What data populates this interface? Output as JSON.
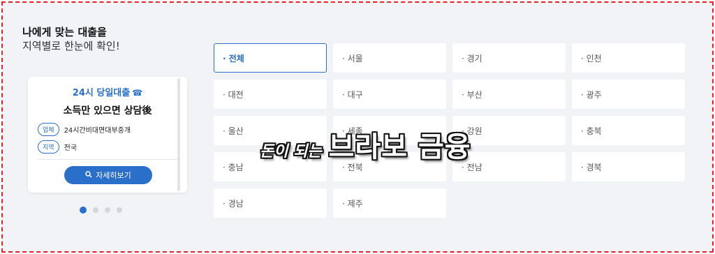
{
  "headline": {
    "line1": "나에게 맞는 대출을",
    "line2": "지역별로 한눈에 확인!"
  },
  "card": {
    "title": "24시 당일대출",
    "title_icon": "phone-icon",
    "subtitle": "소득만 있으면 상담後",
    "rows": [
      {
        "tag": "업체",
        "value": "24시간비대면대부중개"
      },
      {
        "tag": "지역",
        "value": "전국"
      }
    ],
    "button_icon": "search-icon",
    "button_label": "자세히보기",
    "accent_color": "#2a6fc9"
  },
  "carousel": {
    "dot_count": 4,
    "active_index": 0
  },
  "regions": [
    {
      "label": "· 전체",
      "active": true
    },
    {
      "label": "· 서울"
    },
    {
      "label": "· 경기"
    },
    {
      "label": "· 인천"
    },
    {
      "label": "· 대전"
    },
    {
      "label": "· 대구"
    },
    {
      "label": "· 부산"
    },
    {
      "label": "· 광주"
    },
    {
      "label": "· 울산"
    },
    {
      "label": "· 세종"
    },
    {
      "label": "· 강원"
    },
    {
      "label": "· 충북"
    },
    {
      "label": "· 충남"
    },
    {
      "label": "· 전북"
    },
    {
      "label": "· 전남"
    },
    {
      "label": "· 경북"
    },
    {
      "label": "· 경남"
    },
    {
      "label": "· 제주"
    }
  ],
  "watermark": {
    "small": "돈이 되는",
    "big": "브라보 금융"
  }
}
